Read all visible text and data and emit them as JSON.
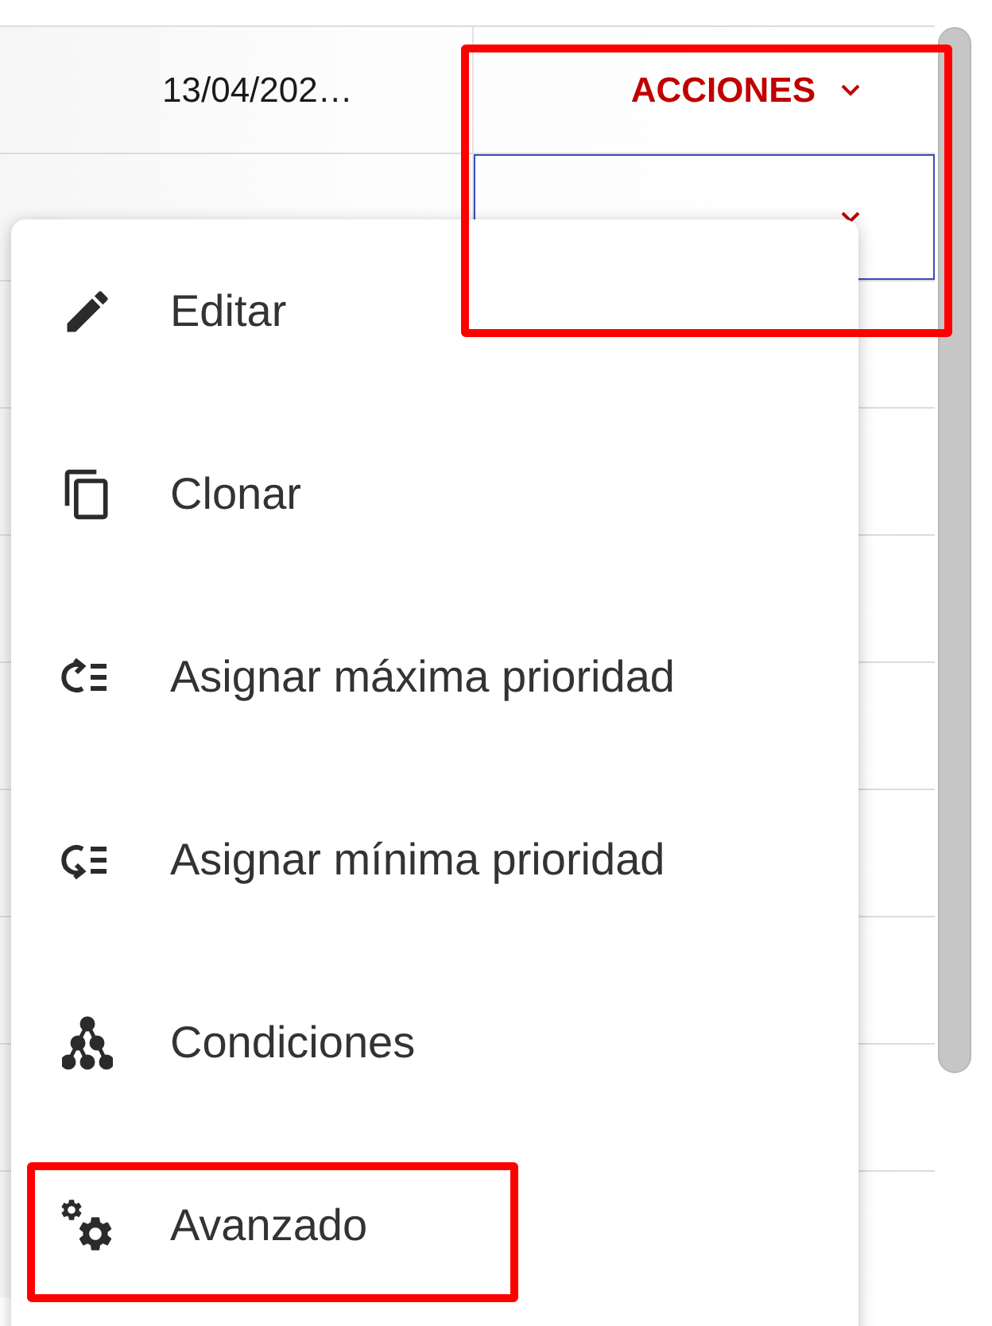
{
  "table": {
    "rows": [
      {
        "date": "13/04/202…",
        "action": "ACCIONES",
        "selected": false
      },
      {
        "selected": true
      }
    ]
  },
  "menu": {
    "items": [
      {
        "label": "Editar",
        "kind": "edit"
      },
      {
        "label": "Clonar",
        "kind": "clone"
      },
      {
        "label": "Asignar máxima prioridad",
        "kind": "raise"
      },
      {
        "label": "Asignar mínima prioridad",
        "kind": "lower"
      },
      {
        "label": "Condiciones",
        "kind": "conditions"
      },
      {
        "label": "Avanzado",
        "kind": "advanced"
      }
    ]
  }
}
